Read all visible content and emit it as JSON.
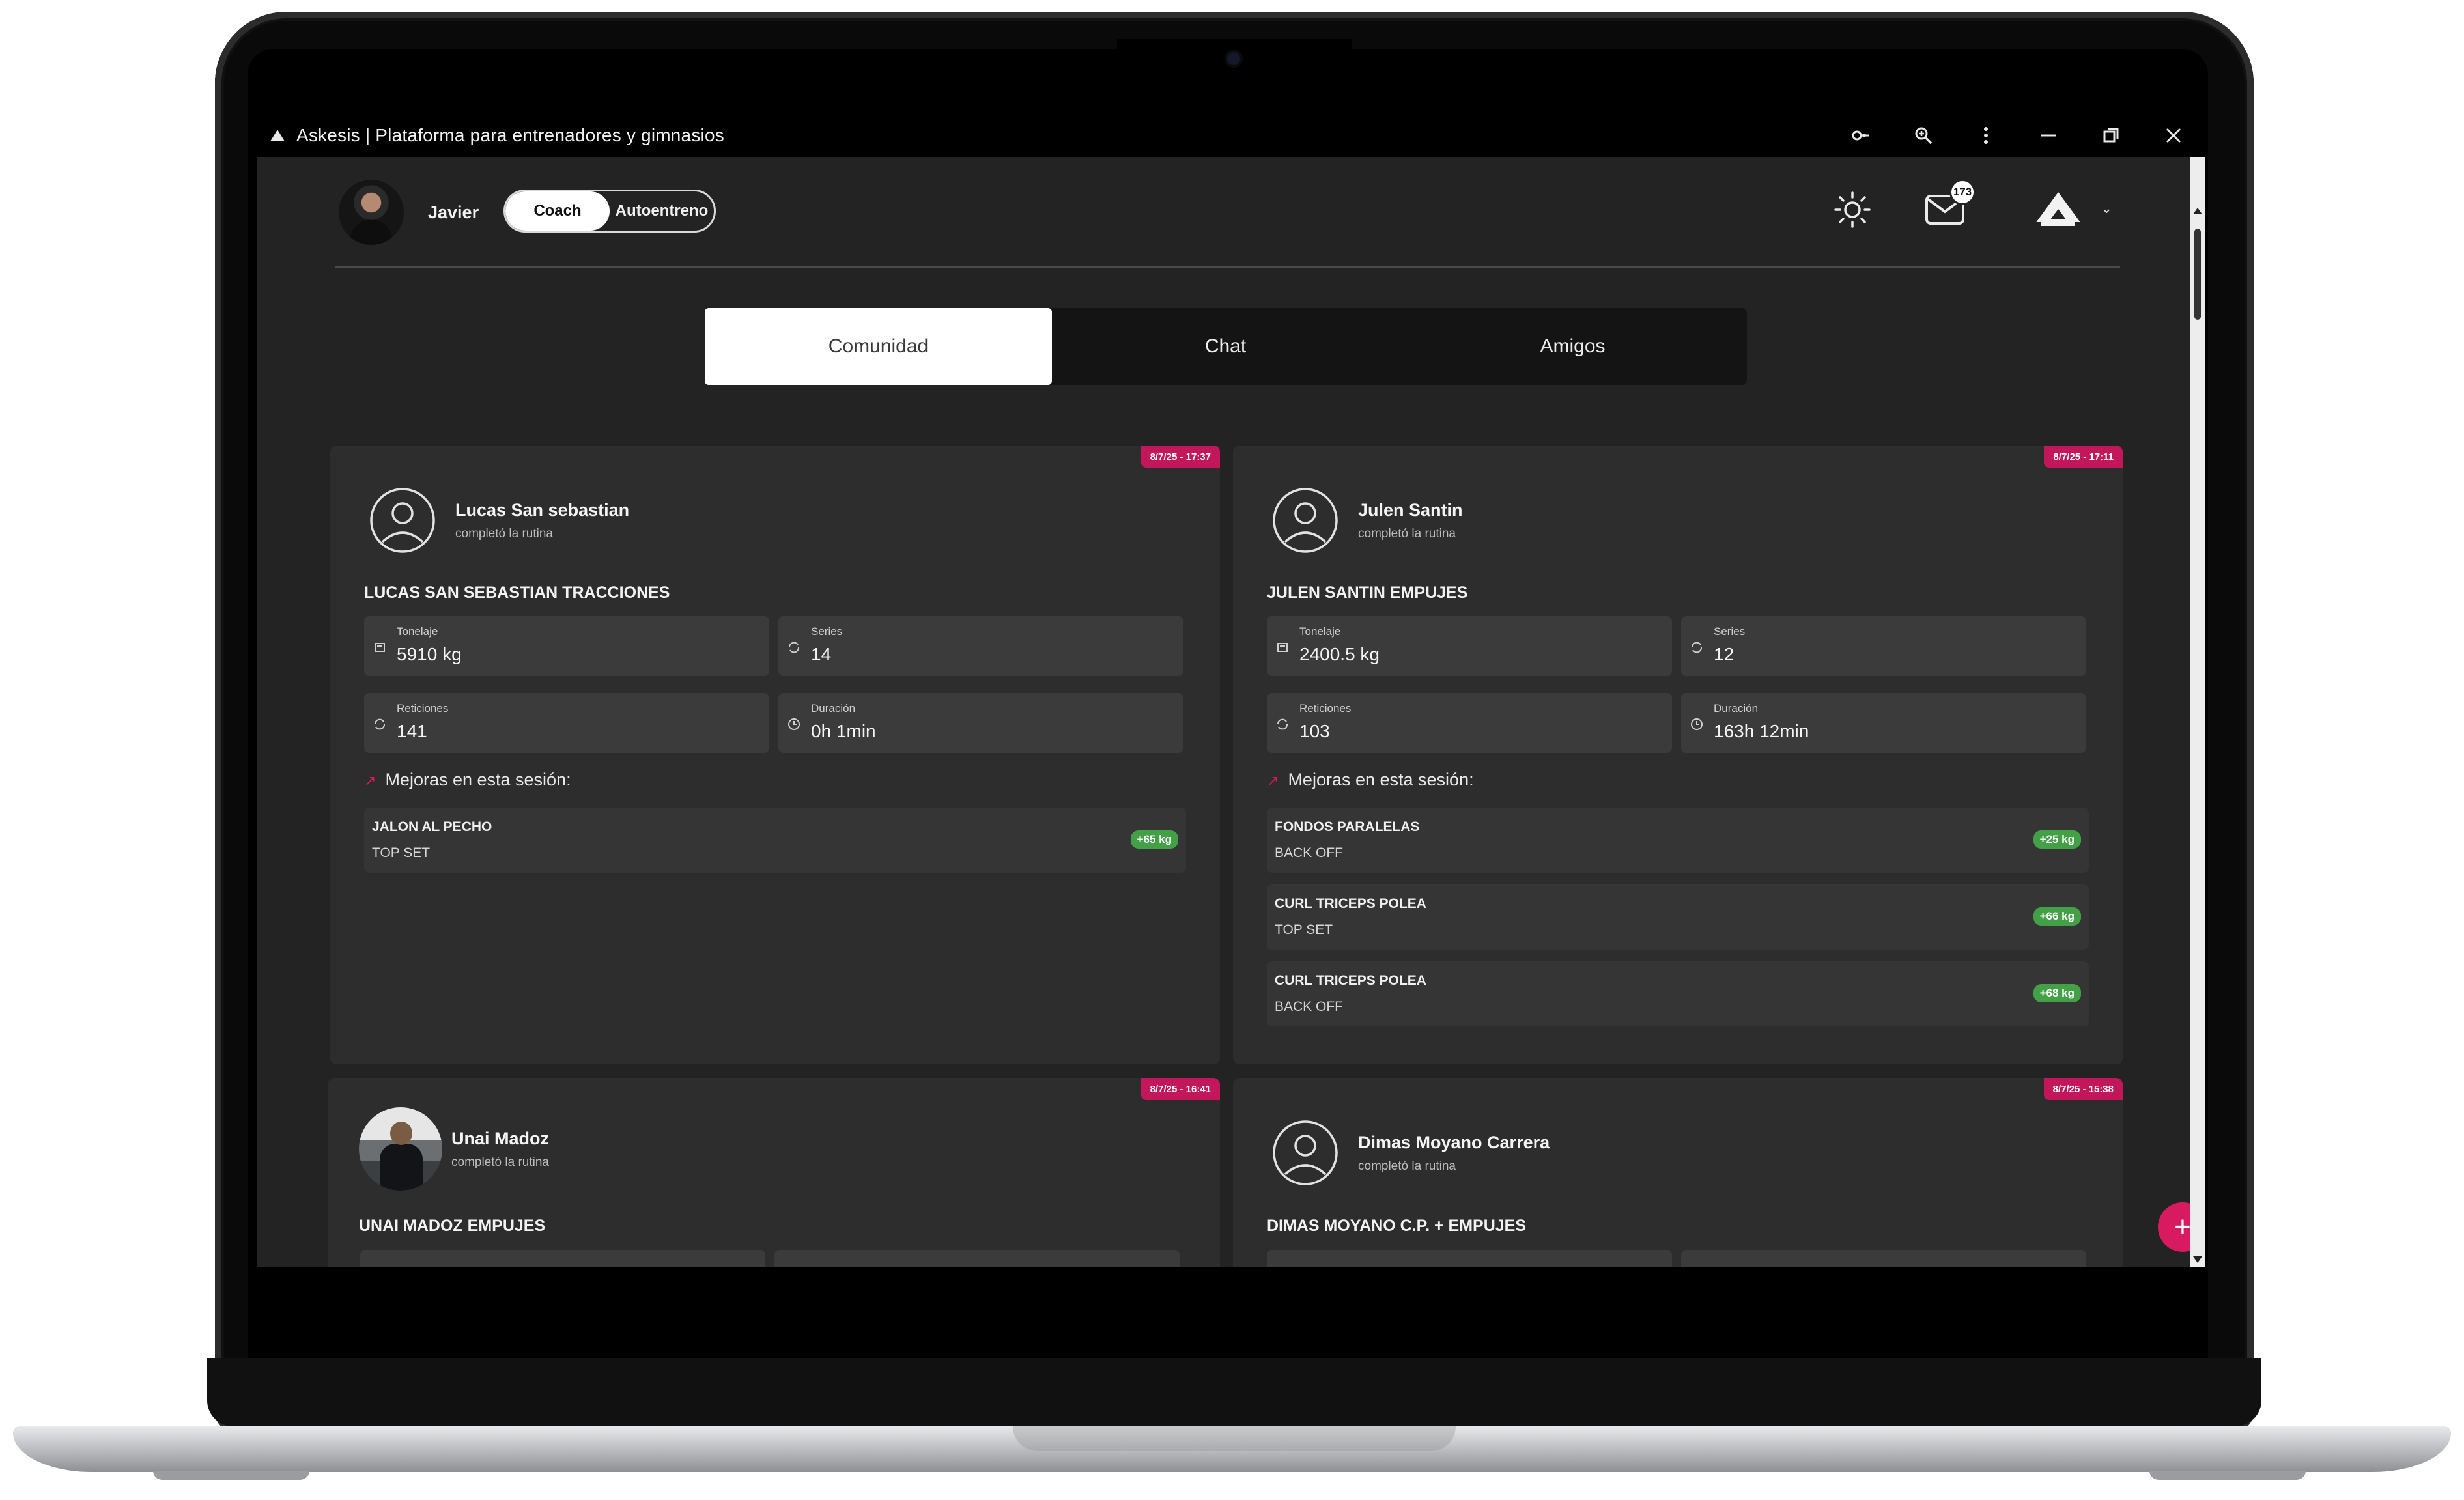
{
  "window": {
    "title": "Askesis | Plataforma para entrenadores y gimnasios",
    "controls": [
      "key-icon",
      "zoom-icon",
      "more-icon",
      "minimize-icon",
      "restore-icon",
      "close-icon"
    ]
  },
  "header": {
    "user_name": "Javier",
    "mode_options": [
      "Coach",
      "Autoentreno"
    ],
    "active_mode": "Coach",
    "mail_badge": "173",
    "accent_color": "#d81b60"
  },
  "tabs": [
    {
      "label": "Comunidad",
      "active": true
    },
    {
      "label": "Chat",
      "active": false
    },
    {
      "label": "Amigos",
      "active": false
    }
  ],
  "feed": [
    {
      "timestamp": "8/7/25 - 17:37",
      "user": "Lucas San sebastian",
      "action": "completó la rutina",
      "routine": "LUCAS SAN SEBASTIAN TRACCIONES",
      "stats": {
        "tonelaje_label": "Tonelaje",
        "tonelaje": "5910 kg",
        "series_label": "Series",
        "series": "14",
        "repeticiones_label": "Reticiones",
        "repeticiones": "141",
        "duracion_label": "Duración",
        "duracion": "0h 1min"
      },
      "improvements_title": "Mejoras en esta sesión:",
      "improvements": [
        {
          "exercise": "JALON AL PECHO",
          "set": "TOP SET",
          "gain": "+65 kg"
        }
      ]
    },
    {
      "timestamp": "8/7/25 - 17:11",
      "user": "Julen Santin",
      "action": "completó la rutina",
      "routine": "JULEN SANTIN EMPUJES",
      "stats": {
        "tonelaje_label": "Tonelaje",
        "tonelaje": "2400.5 kg",
        "series_label": "Series",
        "series": "12",
        "repeticiones_label": "Reticiones",
        "repeticiones": "103",
        "duracion_label": "Duración",
        "duracion": "163h 12min"
      },
      "improvements_title": "Mejoras en esta sesión:",
      "improvements": [
        {
          "exercise": "FONDOS PARALELAS",
          "set": "BACK OFF",
          "gain": "+25 kg"
        },
        {
          "exercise": "CURL TRICEPS POLEA",
          "set": "TOP SET",
          "gain": "+66 kg"
        },
        {
          "exercise": "CURL TRICEPS POLEA",
          "set": "BACK OFF",
          "gain": "+68 kg"
        }
      ]
    },
    {
      "timestamp": "8/7/25 - 16:41",
      "user": "Unai Madoz",
      "action": "completó la rutina",
      "routine": "UNAI MADOZ EMPUJES"
    },
    {
      "timestamp": "8/7/25 - 15:38",
      "user": "Dimas Moyano Carrera",
      "action": "completó la rutina",
      "routine": "DIMAS MOYANO C.P. + EMPUJES"
    }
  ],
  "fab": {
    "label": "+"
  }
}
